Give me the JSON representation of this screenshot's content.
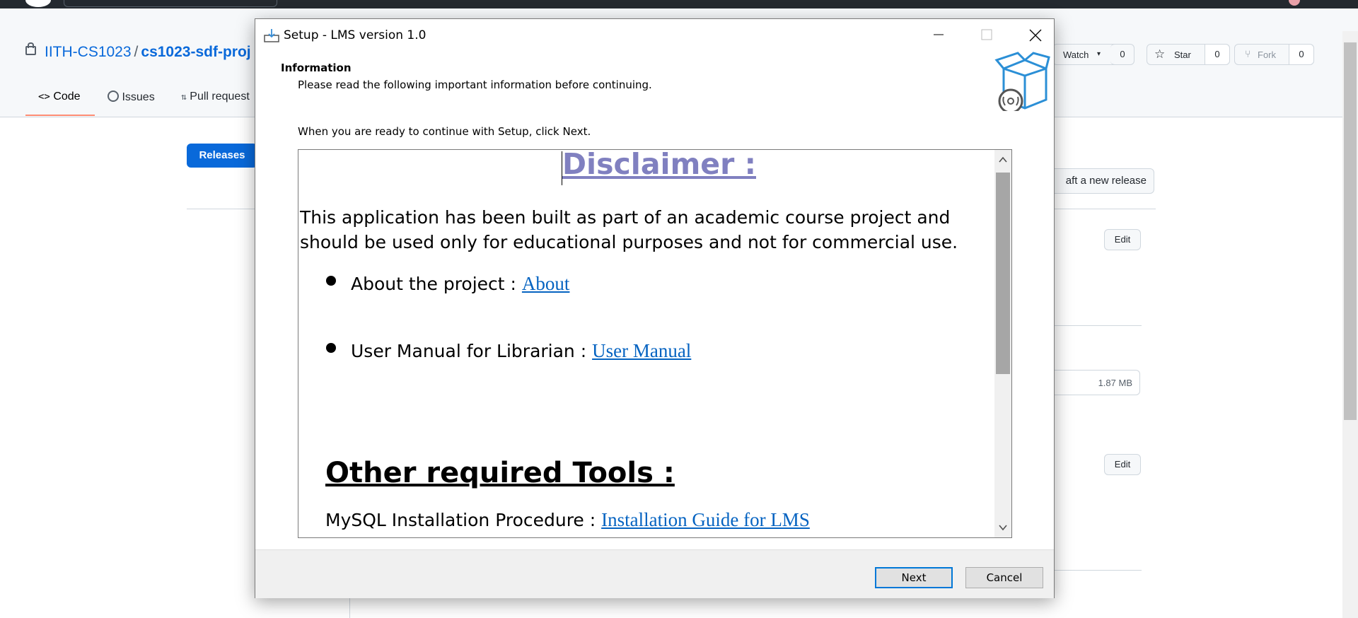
{
  "background": {
    "repo": {
      "owner": "IITH-CS1023",
      "separator": "/",
      "name": "cs1023-sdf-proj"
    },
    "tabs": [
      {
        "label": "Code",
        "icon": "code-icon"
      },
      {
        "label": "Issues",
        "icon": "issue-icon"
      },
      {
        "label": "Pull request",
        "icon": "pull-request-icon"
      }
    ],
    "watch": {
      "label": "Watch",
      "count": "0"
    },
    "star": {
      "label": "Star",
      "count": "0"
    },
    "fork": {
      "label": "Fork",
      "count": "0"
    },
    "releases_label": "Releases",
    "draft_label": "aft a new release",
    "edit_label": "Edit",
    "asset_size": "1.87 MB",
    "colors": {
      "accent": "#0969da",
      "header_bg": "#24292f"
    }
  },
  "dialog": {
    "title": "Setup - LMS version 1.0",
    "section_title": "Information",
    "section_subtitle": "Please read the following important information before continuing.",
    "ready_text": "When you are ready to continue with Setup, click Next.",
    "content": {
      "disclaimer_title": "Disclaimer : ",
      "paragraph": "This application has been built as part of an academic course project and should be used only for educational purposes and not for commercial use.",
      "items": [
        {
          "text": "About the project : ",
          "link": "About"
        },
        {
          "text": "User Manual for Librarian : ",
          "link": "User Manual"
        }
      ],
      "tools_title": "Other required Tools :",
      "tools_line": {
        "text": "MySQL Installation Procedure : ",
        "link": "Installation Guide for LMS"
      }
    },
    "buttons": {
      "next": "Next",
      "cancel": "Cancel"
    },
    "colors": {
      "disclaimer": "#8080c0",
      "link": "#0563c1",
      "default_button_border": "#0078d7"
    }
  }
}
